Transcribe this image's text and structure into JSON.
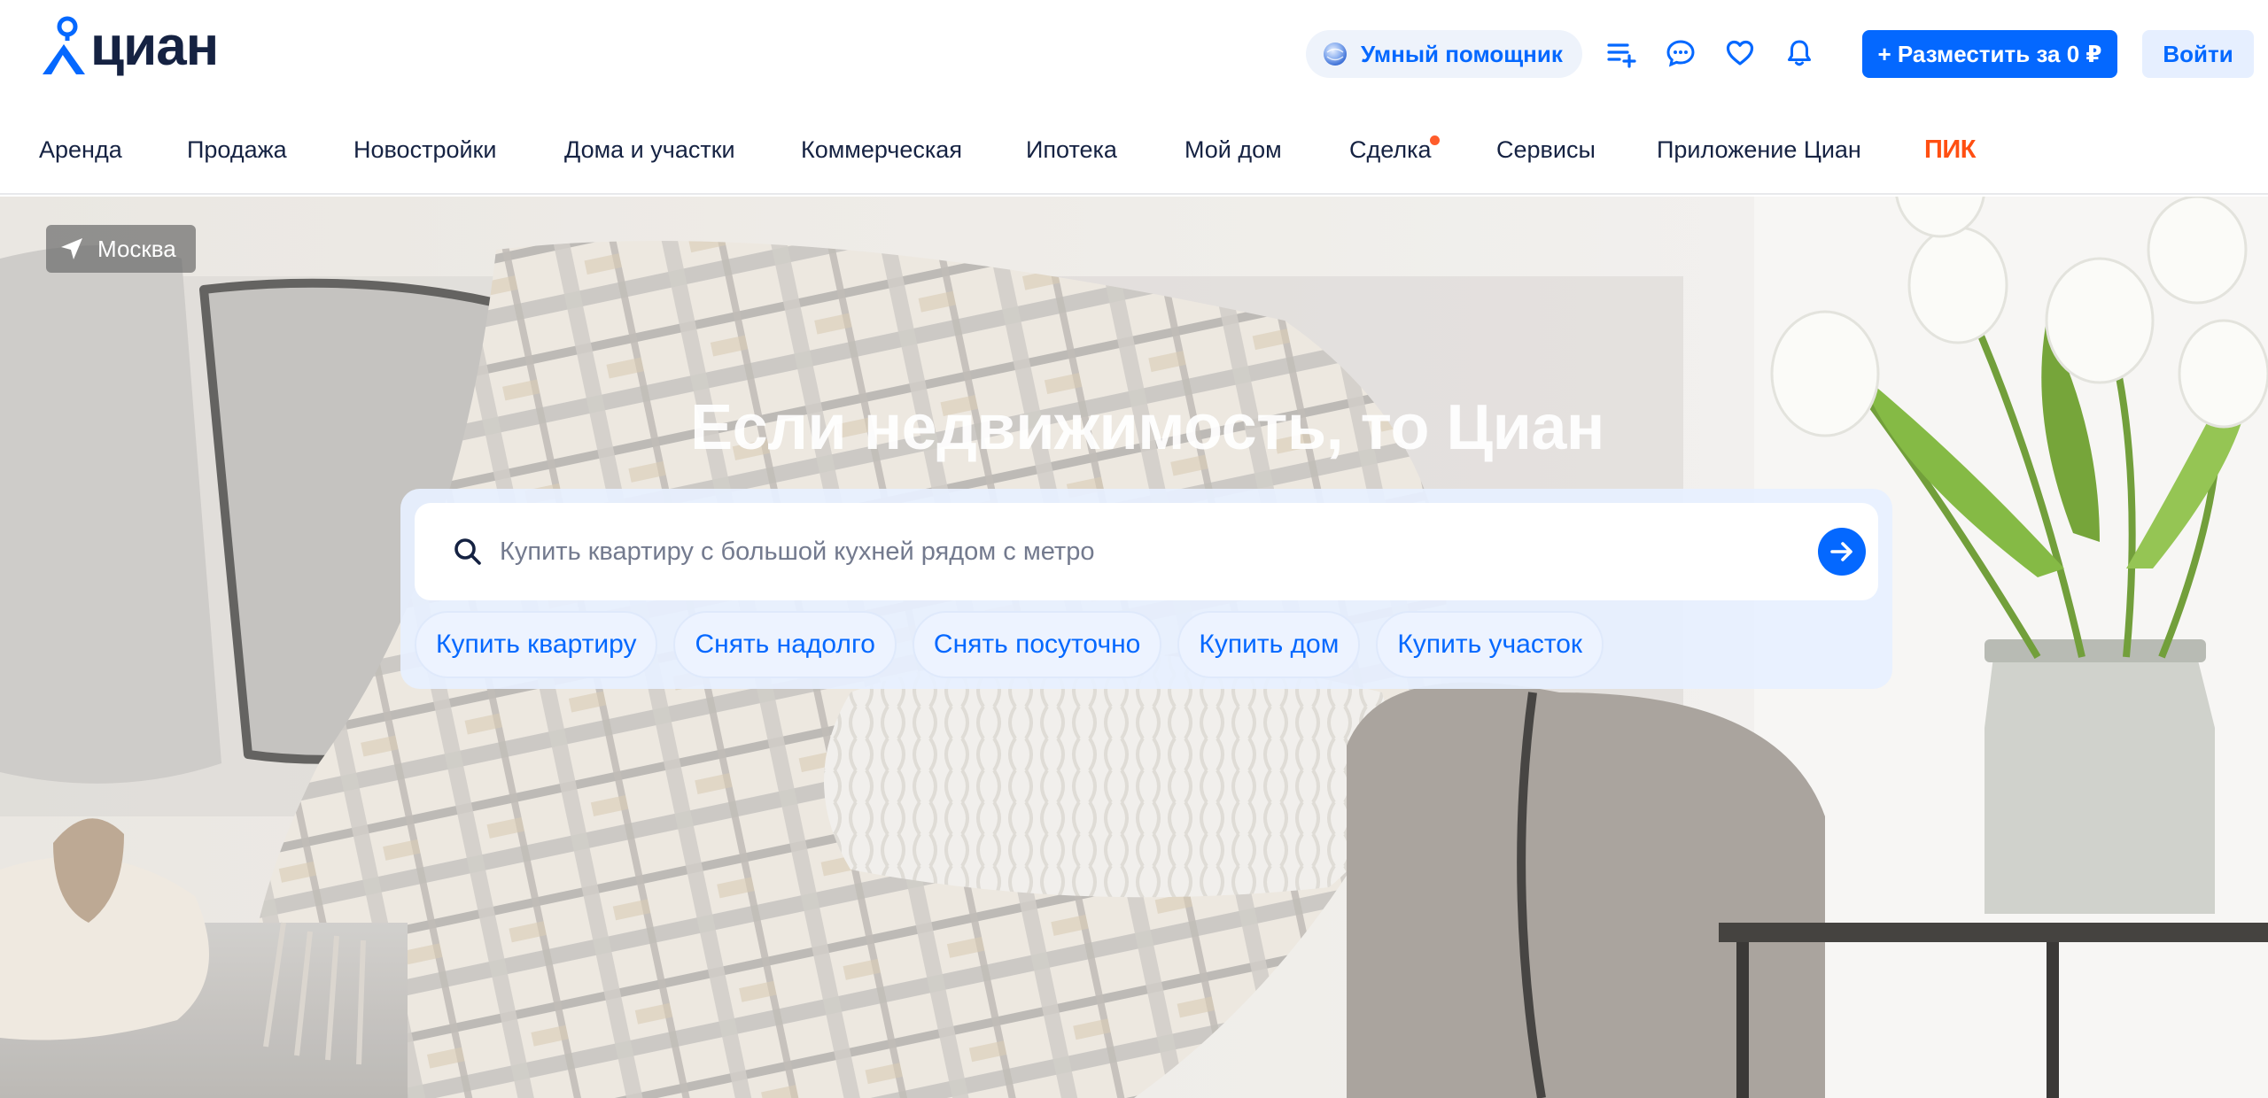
{
  "header": {
    "logo_text": "циан",
    "assistant_label": "Умный помощник",
    "place_ad_label": "+ Разместить за 0 ₽",
    "login_label": "Войти",
    "icons": [
      "compare-list-icon",
      "chat-icon",
      "heart-icon",
      "bell-icon"
    ]
  },
  "nav": {
    "items": [
      {
        "label": "Аренда"
      },
      {
        "label": "Продажа"
      },
      {
        "label": "Новостройки"
      },
      {
        "label": "Дома и участки"
      },
      {
        "label": "Коммерческая"
      },
      {
        "label": "Ипотека"
      },
      {
        "label": "Мой дом"
      },
      {
        "label": "Сделка",
        "has_dot": true
      },
      {
        "label": "Сервисы"
      },
      {
        "label": "Приложение Циан"
      },
      {
        "label": "ПИК",
        "brand": true
      }
    ]
  },
  "hero": {
    "city_label": "Москва",
    "title": "Если недвижимость, то Циан",
    "search_placeholder": "Купить квартиру с большой кухней рядом с метро",
    "chips": [
      "Купить квартиру",
      "Снять надолго",
      "Снять посуточно",
      "Купить дом",
      "Купить участок"
    ]
  },
  "colors": {
    "accent": "#0468ff",
    "text": "#152242",
    "brand_pik": "#ff4f12",
    "notification_dot": "#ff5c2b"
  }
}
